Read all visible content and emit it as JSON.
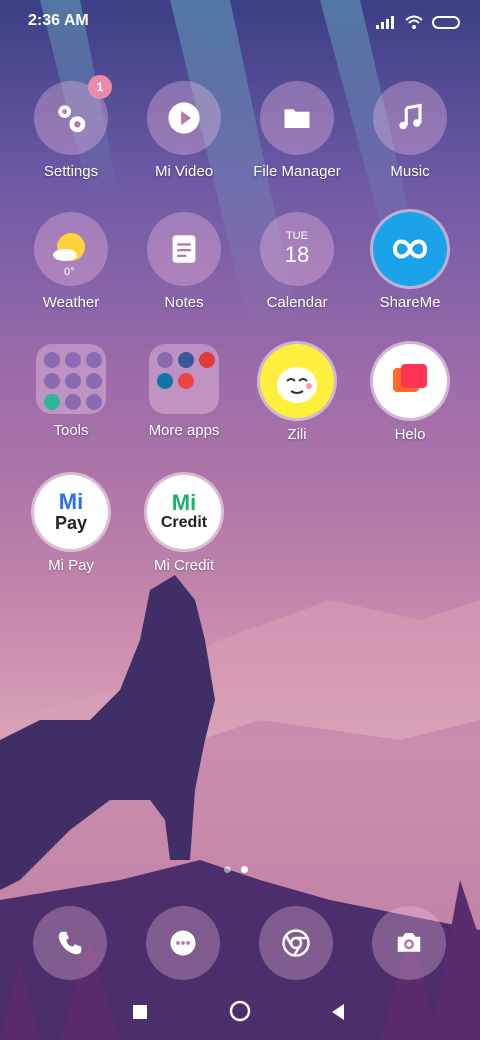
{
  "status": {
    "time": "2:36 AM"
  },
  "apps": {
    "settings": {
      "label": "Settings",
      "badge": "1"
    },
    "mivideo": {
      "label": "Mi Video"
    },
    "filemanager": {
      "label": "File Manager"
    },
    "music": {
      "label": "Music"
    },
    "weather": {
      "label": "Weather",
      "temp": "0°"
    },
    "notes": {
      "label": "Notes"
    },
    "calendar": {
      "label": "Calendar",
      "day": "TUE",
      "date": "18"
    },
    "shareme": {
      "label": "ShareMe"
    },
    "tools": {
      "label": "Tools"
    },
    "moreapps": {
      "label": "More apps"
    },
    "zili": {
      "label": "Zili"
    },
    "helo": {
      "label": "Helo"
    },
    "mipay": {
      "label": "Mi Pay",
      "logo_top": "Mi",
      "logo_bottom": "Pay"
    },
    "micredit": {
      "label": "Mi Credit",
      "logo_top": "Mi",
      "logo_bottom": "Credit"
    }
  },
  "dock": [
    "phone-icon",
    "messages-icon",
    "browser-icon",
    "camera-icon"
  ],
  "page_indicator": {
    "pages": 2,
    "current": 2
  },
  "colors": {
    "accent": "#e88ba8",
    "shareme": "#1aa3e8",
    "helo_orange": "#ff6a2b"
  }
}
